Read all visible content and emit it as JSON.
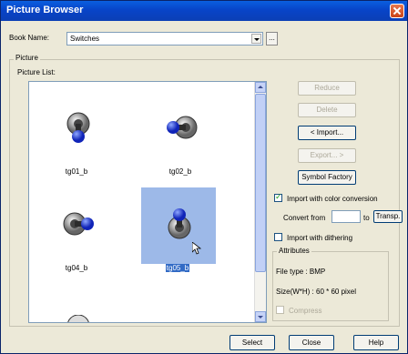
{
  "window": {
    "title": "Picture Browser"
  },
  "book": {
    "label": "Book Name:",
    "value": "Switches",
    "browse_label": "..."
  },
  "picture_group": {
    "label": "Picture",
    "list_label": "Picture List:"
  },
  "pictures": [
    {
      "caption": "tg01_b",
      "selected": false
    },
    {
      "caption": "tg02_b",
      "selected": false
    },
    {
      "caption": "tg04_b",
      "selected": false
    },
    {
      "caption": "tg05_b",
      "selected": true
    }
  ],
  "actions": {
    "reduce": "Reduce",
    "delete": "Delete",
    "import": "< Import...",
    "export": "Export... >",
    "symbol_factory": "Symbol Factory"
  },
  "options": {
    "import_color_conversion": "Import with color conversion",
    "convert_from": "Convert from",
    "to": "to",
    "transp": "Transp.",
    "import_dithering": "Import with dithering"
  },
  "attributes": {
    "label": "Attributes",
    "file_type": "File type :  BMP",
    "size": "Size(W*H) : 60 * 60 pixel",
    "compress": "Compress"
  },
  "footer": {
    "select": "Select",
    "close": "Close",
    "help": "Help"
  },
  "colors": {
    "titlebar": "#0a4fd6",
    "selection": "#316ac5",
    "highlight": "#9db9e8"
  }
}
